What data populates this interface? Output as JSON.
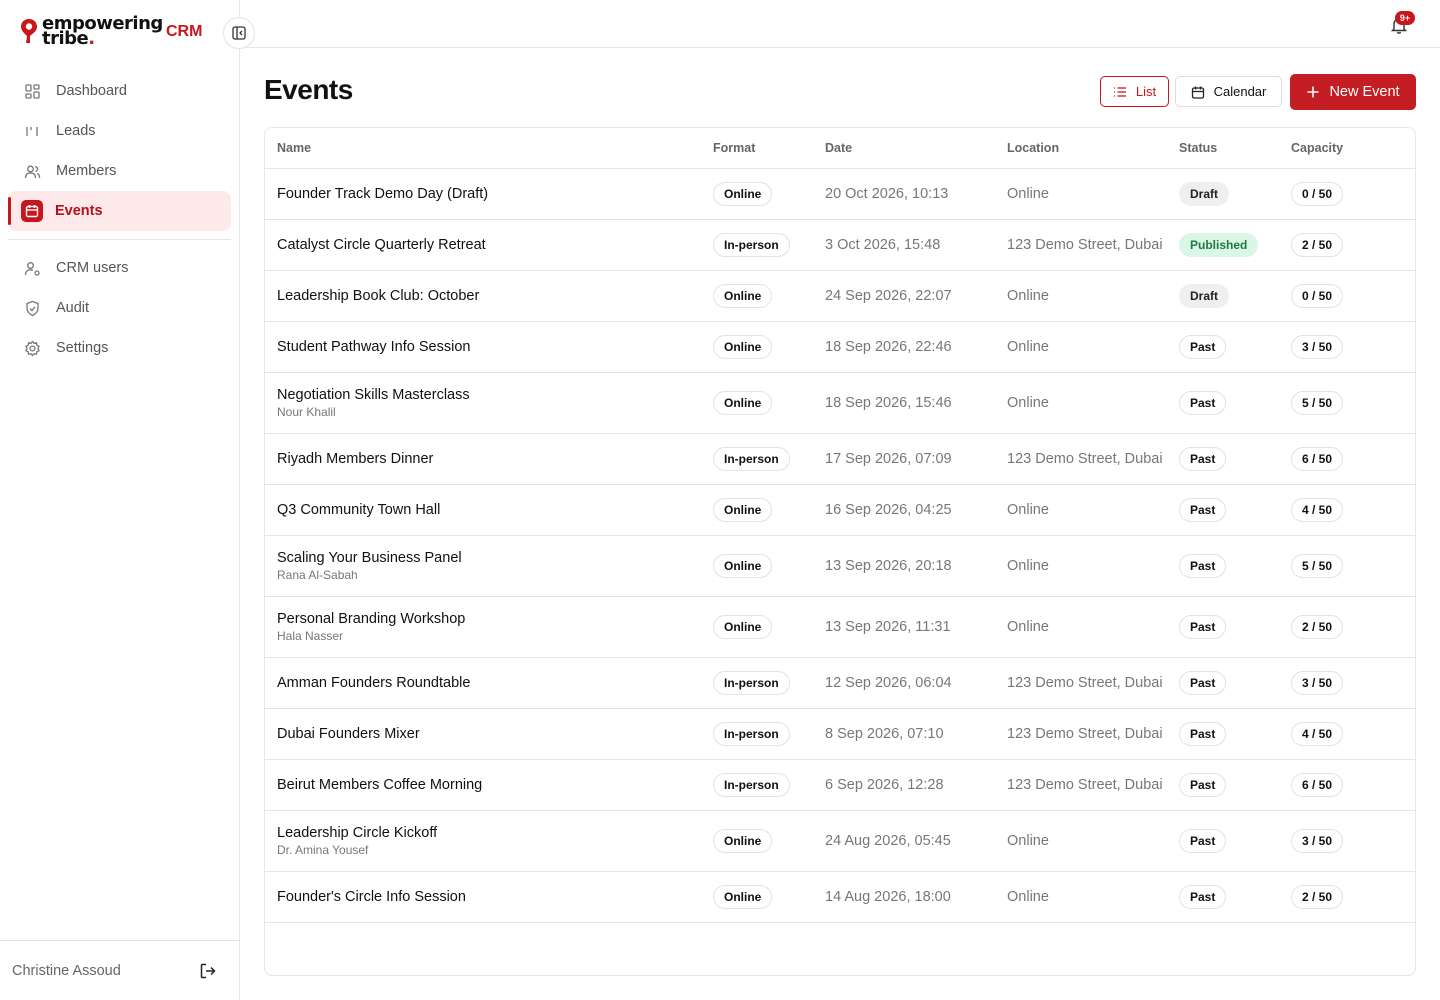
{
  "brand": {
    "word1": "empowering",
    "word2": "tribe",
    "dot": ".",
    "tag": "CRM",
    "brand_color": "#c8161d"
  },
  "sidebar": {
    "items": [
      {
        "label": "Dashboard",
        "icon": "grid-icon"
      },
      {
        "label": "Leads",
        "icon": "leads-icon"
      },
      {
        "label": "Members",
        "icon": "users-icon"
      },
      {
        "label": "Events",
        "icon": "calendar-icon",
        "active": true
      }
    ],
    "items2": [
      {
        "label": "CRM users",
        "icon": "user-gear-icon"
      },
      {
        "label": "Audit",
        "icon": "shield-icon"
      },
      {
        "label": "Settings",
        "icon": "gear-icon"
      }
    ],
    "user": "Christine Assoud"
  },
  "header": {
    "notifications_badge": "9+"
  },
  "page": {
    "title": "Events",
    "list_label": "List",
    "calendar_label": "Calendar",
    "new_label": "New Event"
  },
  "table": {
    "columns": [
      "Name",
      "Format",
      "Date",
      "Location",
      "Status",
      "Capacity"
    ],
    "rows": [
      {
        "name": "Founder Track Demo Day (Draft)",
        "sub": "",
        "format": "Online",
        "date": "20 Oct 2026, 10:13",
        "location": "Online",
        "status": "Draft",
        "capacity": "0 / 50"
      },
      {
        "name": "Catalyst Circle Quarterly Retreat",
        "sub": "",
        "format": "In-person",
        "date": "3 Oct 2026, 15:48",
        "location": "123 Demo Street, Dubai",
        "status": "Published",
        "capacity": "2 / 50"
      },
      {
        "name": "Leadership Book Club: October",
        "sub": "",
        "format": "Online",
        "date": "24 Sep 2026, 22:07",
        "location": "Online",
        "status": "Draft",
        "capacity": "0 / 50"
      },
      {
        "name": "Student Pathway Info Session",
        "sub": "",
        "format": "Online",
        "date": "18 Sep 2026, 22:46",
        "location": "Online",
        "status": "Past",
        "capacity": "3 / 50"
      },
      {
        "name": "Negotiation Skills Masterclass",
        "sub": "Nour Khalil",
        "format": "Online",
        "date": "18 Sep 2026, 15:46",
        "location": "Online",
        "status": "Past",
        "capacity": "5 / 50"
      },
      {
        "name": "Riyadh Members Dinner",
        "sub": "",
        "format": "In-person",
        "date": "17 Sep 2026, 07:09",
        "location": "123 Demo Street, Dubai",
        "status": "Past",
        "capacity": "6 / 50"
      },
      {
        "name": "Q3 Community Town Hall",
        "sub": "",
        "format": "Online",
        "date": "16 Sep 2026, 04:25",
        "location": "Online",
        "status": "Past",
        "capacity": "4 / 50"
      },
      {
        "name": "Scaling Your Business Panel",
        "sub": "Rana Al-Sabah",
        "format": "Online",
        "date": "13 Sep 2026, 20:18",
        "location": "Online",
        "status": "Past",
        "capacity": "5 / 50"
      },
      {
        "name": "Personal Branding Workshop",
        "sub": "Hala Nasser",
        "format": "Online",
        "date": "13 Sep 2026, 11:31",
        "location": "Online",
        "status": "Past",
        "capacity": "2 / 50"
      },
      {
        "name": "Amman Founders Roundtable",
        "sub": "",
        "format": "In-person",
        "date": "12 Sep 2026, 06:04",
        "location": "123 Demo Street, Dubai",
        "status": "Past",
        "capacity": "3 / 50"
      },
      {
        "name": "Dubai Founders Mixer",
        "sub": "",
        "format": "In-person",
        "date": "8 Sep 2026, 07:10",
        "location": "123 Demo Street, Dubai",
        "status": "Past",
        "capacity": "4 / 50"
      },
      {
        "name": "Beirut Members Coffee Morning",
        "sub": "",
        "format": "In-person",
        "date": "6 Sep 2026, 12:28",
        "location": "123 Demo Street, Dubai",
        "status": "Past",
        "capacity": "6 / 50"
      },
      {
        "name": "Leadership Circle Kickoff",
        "sub": "Dr. Amina Yousef",
        "format": "Online",
        "date": "24 Aug 2026, 05:45",
        "location": "Online",
        "status": "Past",
        "capacity": "3 / 50"
      },
      {
        "name": "Founder's Circle Info Session",
        "sub": "",
        "format": "Online",
        "date": "14 Aug 2026, 18:00",
        "location": "Online",
        "status": "Past",
        "capacity": "2 / 50"
      }
    ]
  }
}
